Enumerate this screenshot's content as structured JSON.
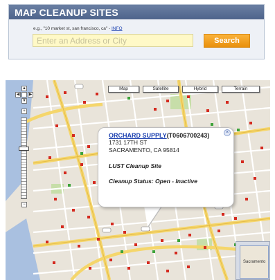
{
  "search": {
    "title": "MAP CLEANUP SITES",
    "hint_text": "e.g., \"10 market st, san francisco, ca\" - ",
    "hint_link": "INFO",
    "placeholder": "Enter an Address or City",
    "button_label": "Search"
  },
  "map": {
    "type_buttons": [
      "Map",
      "Satellite",
      "Hybrid",
      "Terrain"
    ],
    "info_window": {
      "site_name": "ORCHARD SUPPLY",
      "site_id": "(T0606700243)",
      "address_line1": "1731 17TH ST",
      "address_line2": "SACRAMENTO, CA 95814",
      "cleanup_type": "LUST Cleanup Site",
      "cleanup_status": "Cleanup Status: Open - Inactive"
    },
    "overview_label": "Sacramento",
    "colors": {
      "major_road": "#f5d66b",
      "minor_road": "#ffffff",
      "marker_red": "#d42a1f",
      "marker_green": "#3da33a",
      "water": "#a9c0e0",
      "park": "#c7dea9"
    }
  }
}
